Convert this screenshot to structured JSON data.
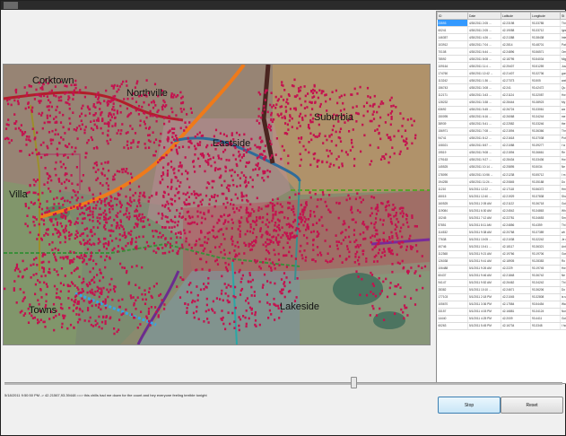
{
  "window": {
    "title": ""
  },
  "map": {
    "labels": {
      "north_west": "Corktown",
      "north": "Northville",
      "east": "Suburbia",
      "center": "Eastside",
      "west": "Villa",
      "south_west": "Towns",
      "south": "Lakeside"
    }
  },
  "grid": {
    "columns": [
      "ID",
      "Date",
      "Latitude",
      "Longitude",
      "St"
    ],
    "rows": [
      [
        "23593",
        "4/30/2011 2:05 ...",
        "42.23198",
        "93.33785",
        "Thr"
      ],
      [
        "60241",
        "4/30/2011 2:05 ...",
        "42.19058",
        "93.33712",
        "Ignr"
      ],
      [
        "146357",
        "4/30/2011 4:26 ...",
        "42.21388",
        "93.38438",
        "Inte"
      ],
      [
        "103912",
        "4/30/2011 7:04 ...",
        "42.2814",
        "93.48701",
        "Pat"
      ],
      [
        "70108",
        "4/30/2011 6:44 ...",
        "42.24896",
        "93.56571",
        "Om"
      ],
      [
        "78592",
        "4/30/2011 8:08 ...",
        "42.18795",
        "93.54034",
        "Mig"
      ],
      [
        "109164",
        "4/30/2011 11:4 ...",
        "42.25407",
        "93.51259",
        "Jus"
      ],
      [
        "174760",
        "4/30/2011 12:42 ...",
        "42.21407",
        "93.32736",
        "gon"
      ],
      [
        "113242",
        "4/30/2011 1:36 ...",
        "42.27373",
        "93.505",
        "wat"
      ],
      [
        "156743",
        "4/30/2011 3:08 ...",
        "42.241",
        "93.42472",
        "Qu"
      ],
      [
        "112171",
        "4/30/2011 3:43 ...",
        "42.21124",
        "93.32087",
        "Hw"
      ],
      [
        "128232",
        "4/30/2011 3:38 ...",
        "42.28444",
        "93.38923",
        "My"
      ],
      [
        "63692",
        "4/30/2011 5:45 ...",
        "42.26724",
        "93.33061",
        "wa"
      ],
      [
        "150095",
        "4/30/2011 6:16 ...",
        "42.26068",
        "93.34244",
        "me"
      ],
      [
        "38939",
        "4/30/2011 5:41 ...",
        "42.22582",
        "93.33246",
        "the"
      ],
      [
        "156971",
        "4/30/2011 7:08 ...",
        "42.21594",
        "93.36366",
        "Thr"
      ],
      [
        "94741",
        "4/30/2011 8:12 ...",
        "42.21618",
        "93.37038",
        "Pot"
      ],
      [
        "108021",
        "4/30/2011 8:57 ...",
        "42.21088",
        "93.39277",
        "I w"
      ],
      [
        "19519",
        "4/30/2011 9:08 ...",
        "42.21594",
        "93.36661",
        "Re"
      ],
      [
        "179163",
        "4/30/2011 9:27 ...",
        "42.28434",
        "93.33436",
        "Hw"
      ],
      [
        "145525",
        "4/30/2011 10:14 ...",
        "42.25895",
        "93.5034",
        "Ne"
      ],
      [
        "178090",
        "4/30/2011 10:56 ...",
        "42.21238",
        "93.55712",
        "I m"
      ],
      [
        "194255",
        "4/30/2011 11:24 ...",
        "42.20845",
        "93.35188",
        "Do"
      ],
      [
        "11210",
        "5/1/2011 12:22 ...",
        "42.17118",
        "93.56372",
        "Hm"
      ],
      [
        "45015",
        "5/1/2011 12:40 ...",
        "42.21929",
        "93.37838",
        "Sho"
      ],
      [
        "160525",
        "5/1/2011 2:05 AM",
        "42.21122",
        "93.36718",
        "Goi"
      ],
      [
        "119084",
        "5/1/2011 6:30 AM",
        "42.24542",
        "93.34863",
        "Wh"
      ],
      [
        "10245",
        "5/1/2011 7:12 AM",
        "42.22781",
        "93.34653",
        "Sm"
      ],
      [
        "57851",
        "5/1/2011 8:11 AM",
        "42.24856",
        "93.4359",
        "Thi"
      ],
      [
        "114532",
        "5/1/2011 9:38 AM",
        "42.20768",
        "93.37389",
        "wh"
      ],
      [
        "77638",
        "5/1/2011 10:05 ...",
        "42.21038",
        "93.32242",
        "Je d"
      ],
      [
        "40746",
        "5/1/2011 10:41 ...",
        "42.18117",
        "93.36321",
        "Ant"
      ],
      [
        "112368",
        "5/1/2011 9:21 AM",
        "42.19766",
        "93.19706",
        "Gor"
      ],
      [
        "126038",
        "5/1/2011 9:41 AM",
        "42.18905",
        "93.28383",
        "Ro"
      ],
      [
        "106488",
        "5/1/2011 9:26 AM",
        "42.2229",
        "93.19745",
        "Hw"
      ],
      [
        "60437",
        "5/1/2011 9:46 AM",
        "42.21848",
        "93.36742",
        "Ne"
      ],
      [
        "94147",
        "5/1/2011 9:52 AM",
        "42.26462",
        "93.34242",
        "Thi"
      ],
      [
        "28382",
        "5/1/2011 10:10 ...",
        "42.24671",
        "93.36206",
        "Do"
      ],
      [
        "177103",
        "5/1/2011 2:18 PM",
        "42.21045",
        "93.32808",
        "is s"
      ],
      [
        "105670",
        "5/1/2011 3:36 PM",
        "42.17584",
        "93.54454",
        "Wa"
      ],
      [
        "33157",
        "5/1/2011 4:03 PM",
        "42.16881",
        "93.34124",
        "Nor"
      ],
      [
        "14440",
        "5/1/2011 4:25 PM",
        "42.2009",
        "93.4411",
        "Goi"
      ],
      [
        "60263",
        "5/1/2011 5:45 PM",
        "42.16734",
        "93.3348",
        "I ho"
      ]
    ]
  },
  "slider": {
    "position": 0.62
  },
  "status_text": "5/18/2011 9:50:50 PM -> 42.21567,93.39448 ==> this chills had me down for the count and hey everyone feeling terrible tonight",
  "buttons": {
    "stop": "Stop",
    "reset": "Reset"
  },
  "colors": {
    "incident_dot": "#c4124f",
    "selection": "#3399ff"
  }
}
